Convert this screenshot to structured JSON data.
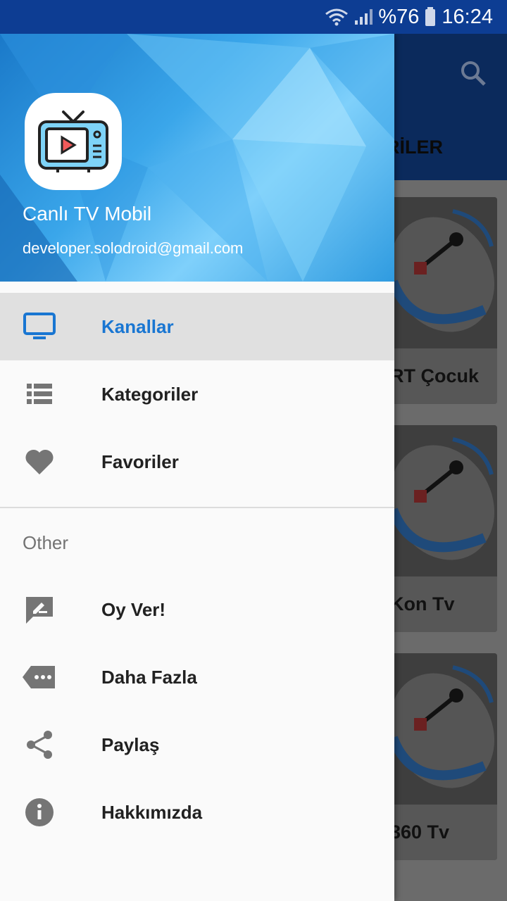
{
  "status_bar": {
    "battery": "%76",
    "time": "16:24"
  },
  "background_app": {
    "tab_fragment": "RİLER",
    "channels": [
      {
        "name": "RT Çocuk"
      },
      {
        "name": "Kon Tv"
      },
      {
        "name": "360 Tv"
      }
    ]
  },
  "drawer": {
    "app_name": "Canlı TV Mobil",
    "email": "developer.solodroid@gmail.com",
    "items": [
      {
        "label": "Kanallar",
        "icon": "tv-icon",
        "active": true
      },
      {
        "label": "Kategoriler",
        "icon": "list-icon",
        "active": false
      },
      {
        "label": "Favoriler",
        "icon": "heart-icon",
        "active": false
      }
    ],
    "section_title": "Other",
    "other_items": [
      {
        "label": "Oy Ver!",
        "icon": "rate-icon"
      },
      {
        "label": "Daha Fazla",
        "icon": "more-icon"
      },
      {
        "label": "Paylaş",
        "icon": "share-icon"
      },
      {
        "label": "Hakkımızda",
        "icon": "info-icon"
      }
    ]
  },
  "colors": {
    "status_bar": "#0d3d93",
    "accent": "#1976d2",
    "icon_gray": "#757575"
  }
}
